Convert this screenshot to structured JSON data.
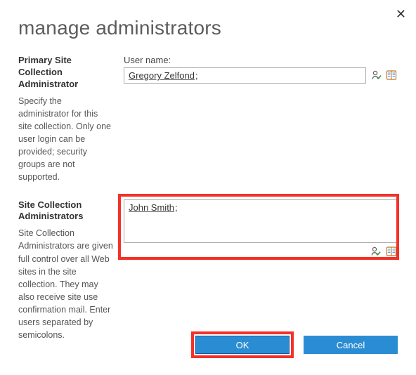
{
  "title": "manage administrators",
  "close_glyph": "✕",
  "sections": {
    "primary": {
      "heading": "Primary Site Collection Administrator",
      "desc": "Specify the administrator for this site collection. Only one user login can be provided; security groups are not supported.",
      "field_label": "User name:",
      "value": "Gregory Zelfond"
    },
    "sca": {
      "heading": "Site Collection Administrators",
      "desc": "Site Collection Administrators are given full control over all Web sites in the site collection. They may also receive site use confirmation mail. Enter users separated by semicolons.",
      "value": "John Smith"
    }
  },
  "buttons": {
    "ok": "OK",
    "cancel": "Cancel"
  },
  "icons": {
    "check_names": "check-names-icon",
    "browse": "browse-directory-icon"
  }
}
